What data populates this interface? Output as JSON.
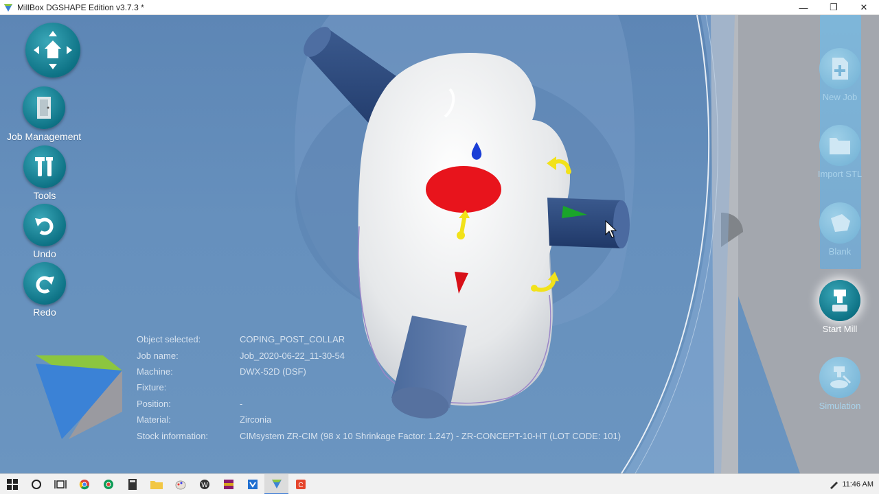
{
  "window": {
    "title": "MillBox DGSHAPE Edition v3.7.3 *",
    "controls": [
      "—",
      "❐",
      "✕"
    ]
  },
  "left_toolbar": {
    "job_management": "Job Management",
    "tools": "Tools",
    "undo": "Undo",
    "redo": "Redo"
  },
  "right_toolbar": {
    "new_job": "New Job",
    "import_stl": "Import STL",
    "blank": "Blank",
    "start_mill": "Start Mill",
    "simulation": "Simulation"
  },
  "info": {
    "rows": [
      {
        "key": "Object selected:",
        "value": "COPING_POST_COLLAR"
      },
      {
        "key": "Job name:",
        "value": "Job_2020-06-22_11-30-54"
      },
      {
        "key": "Machine:",
        "value": "DWX-52D (DSF)"
      },
      {
        "key": "Fixture:",
        "value": ""
      },
      {
        "key": "Position:",
        "value": "-"
      },
      {
        "key": "Material:",
        "value": "Zirconia"
      },
      {
        "key": "Stock information:",
        "value": "CIMsystem ZR-CIM (98 x 10 Shrinkage Factor: 1.247) - ZR-CONCEPT-10-HT (LOT CODE: 101)"
      }
    ]
  },
  "taskbar": {
    "clock": "11:46 AM"
  },
  "colors": {
    "accent": "#0e7386",
    "viewport": "#6690bd",
    "marker_red": "#e8141c",
    "arrow_yellow": "#f2e21a"
  }
}
